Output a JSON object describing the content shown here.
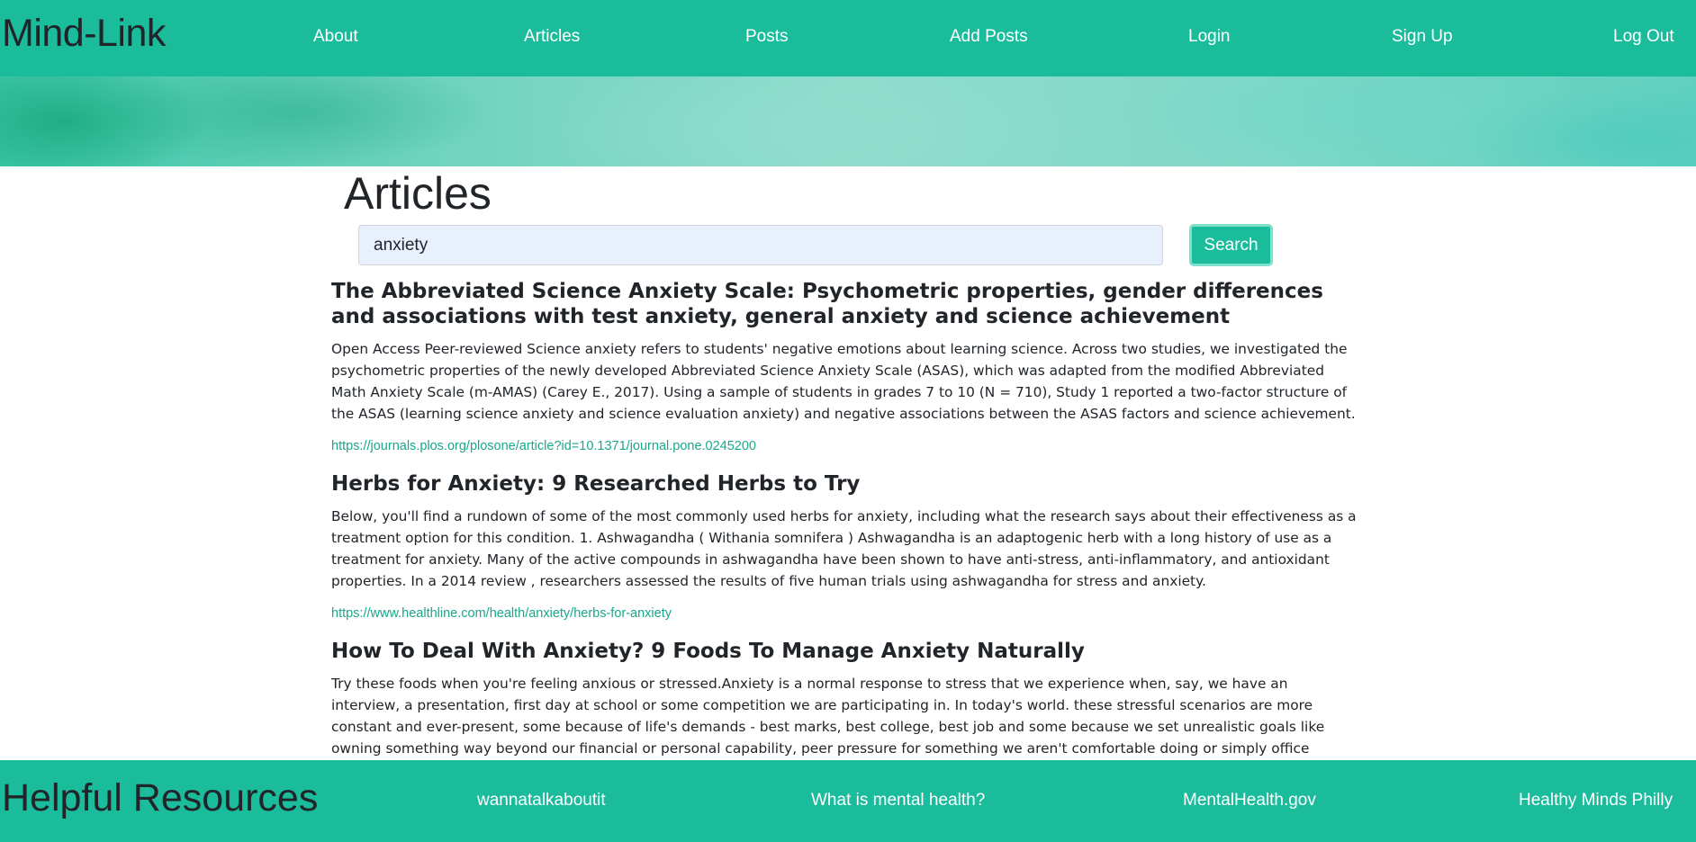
{
  "navbar": {
    "brand": "Mind-Link",
    "links": [
      "About",
      "Articles",
      "Posts",
      "Add Posts",
      "Login",
      "Sign Up",
      "Log Out"
    ]
  },
  "page": {
    "title": "Articles"
  },
  "search": {
    "value": "anxiety",
    "button_label": "Search"
  },
  "articles": [
    {
      "title": "The Abbreviated Science Anxiety Scale: Psychometric properties, gender differences and associations with test anxiety, general anxiety and science achievement",
      "body": "Open Access Peer-reviewed Science anxiety refers to students' negative emotions about learning science. Across two studies, we investigated the psychometric properties of the newly developed Abbreviated Science Anxiety Scale (ASAS), which was adapted from the modified Abbreviated Math Anxiety Scale (m-AMAS) (Carey E., 2017). Using a sample of students in grades 7 to 10 (N = 710), Study 1 reported a two-factor structure of the ASAS (learning science anxiety and science evaluation anxiety) and negative associations between the ASAS factors and science achievement.",
      "url": "https://journals.plos.org/plosone/article?id=10.1371/journal.pone.0245200"
    },
    {
      "title": "Herbs for Anxiety: 9 Researched Herbs to Try",
      "body": "Below, you'll find a rundown of some of the most commonly used herbs for anxiety, including what the research says about their effectiveness as a treatment option for this condition. 1. Ashwagandha ( Withania somnifera ) Ashwagandha is an adaptogenic herb with a long history of use as a treatment for anxiety. Many of the active compounds in ashwagandha have been shown to have anti-stress, anti-inflammatory, and antioxidant properties. In a 2014 review , researchers assessed the results of five human trials using ashwagandha for stress and anxiety.",
      "url": "https://www.healthline.com/health/anxiety/herbs-for-anxiety"
    },
    {
      "title": "How To Deal With Anxiety? 9 Foods To Manage Anxiety Naturally",
      "body": "Try these foods when you're feeling anxious or stressed.Anxiety is a normal response to stress that we experience when, say, we have an interview, a presentation, first day at school or some competition we are participating in. In today's world. these stressful scenarios are more constant and ever-present, some because of life's demands - best marks, best college, best job and some because we set unrealistic goals like owning something way beyond our financial or personal capability, peer pressure for something we aren't comfortable doing or simply office"
    }
  ],
  "footer": {
    "title": "Helpful Resources",
    "links": [
      "wannatalkaboutit",
      "What is mental health?",
      "MentalHealth.gov",
      "Healthy Minds Philly"
    ]
  },
  "colors": {
    "accent": "#1abc9c",
    "link": "#18a88a",
    "input_bg": "#e8f0fe"
  }
}
